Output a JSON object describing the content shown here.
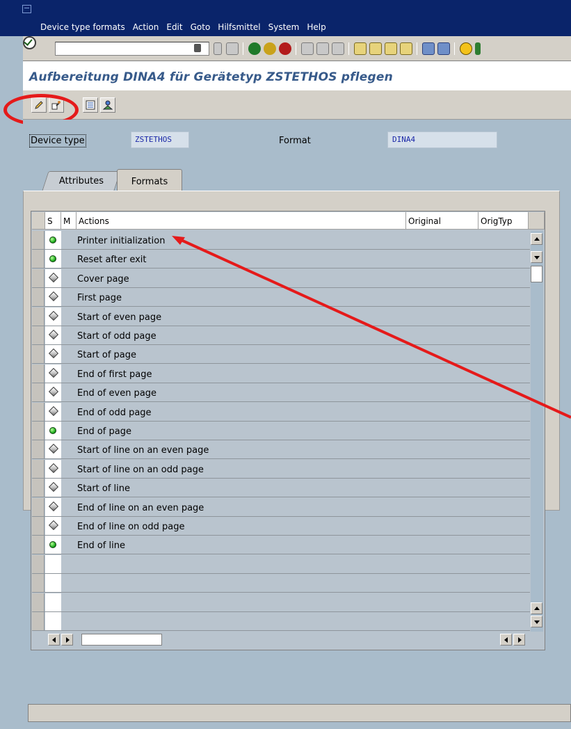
{
  "menu": {
    "items": [
      "Device type formats",
      "Action",
      "Edit",
      "Goto",
      "Hilfsmittel",
      "System",
      "Help"
    ]
  },
  "toolbar": {
    "command_field_value": "",
    "icons": [
      "enter-icon",
      "command-field-dropdown-icon",
      "back-nav-icon",
      "save-icon",
      "back-icon",
      "exit-icon",
      "cancel-icon",
      "print-icon",
      "find-icon",
      "find-next-icon",
      "first-page-icon",
      "previous-page-icon",
      "next-page-icon",
      "last-page-icon",
      "create-session-icon",
      "shortcut-icon",
      "help-icon"
    ]
  },
  "page": {
    "title": "Aufbereitung DINA4 für Gerätetyp ZSTETHOS pflegen"
  },
  "app_toolbar": {
    "icons": [
      "change-pencil-icon",
      "display-change-icon",
      "details-icon",
      "org-icon"
    ]
  },
  "fields": {
    "device_type_label": "Device type",
    "device_type_value": "ZSTETHOS",
    "format_label": "Format",
    "format_value": "DINA4"
  },
  "tabs": [
    {
      "label": "Attributes",
      "active": false
    },
    {
      "label": "Formats",
      "active": true
    }
  ],
  "table": {
    "columns": [
      "S",
      "M",
      "Actions",
      "Original",
      "OrigTyp"
    ],
    "rows": [
      {
        "status": "green",
        "action": "Printer initialization"
      },
      {
        "status": "green",
        "action": "Reset after exit"
      },
      {
        "status": "diamond",
        "action": "Cover page"
      },
      {
        "status": "diamond",
        "action": "First page"
      },
      {
        "status": "diamond",
        "action": "Start of even page"
      },
      {
        "status": "diamond",
        "action": "Start of odd page"
      },
      {
        "status": "diamond",
        "action": "Start of page"
      },
      {
        "status": "diamond",
        "action": "End of first page"
      },
      {
        "status": "diamond",
        "action": "End of even page"
      },
      {
        "status": "diamond",
        "action": "End of odd page"
      },
      {
        "status": "green",
        "action": "End of page"
      },
      {
        "status": "diamond",
        "action": "Start of line on an even page"
      },
      {
        "status": "diamond",
        "action": "Start of line on an odd page"
      },
      {
        "status": "diamond",
        "action": "Start of line"
      },
      {
        "status": "diamond",
        "action": "End of line on an even page"
      },
      {
        "status": "diamond",
        "action": "End of line on odd page"
      },
      {
        "status": "green",
        "action": "End of line"
      },
      {
        "status": "",
        "action": ""
      },
      {
        "status": "",
        "action": ""
      },
      {
        "status": "",
        "action": ""
      },
      {
        "status": "",
        "action": ""
      }
    ]
  },
  "colors": {
    "title_bar": "#0a246a",
    "title_text": "#375a8a",
    "background": "#a9bccb",
    "annotation": "#e51a1a"
  }
}
